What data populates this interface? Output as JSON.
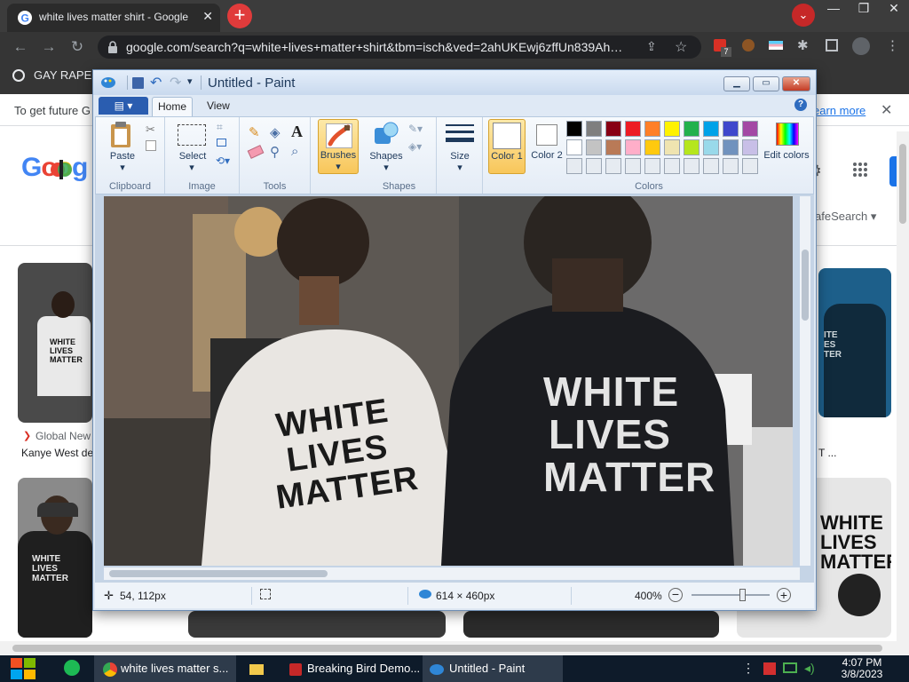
{
  "browser": {
    "tab_title": "white lives matter shirt - Google",
    "url": "google.com/search?q=white+lives+matter+shirt&tbm=isch&ved=2ahUKEwj6zffUn839Ah…",
    "bookmark": "GAY RAPE",
    "extension_badge": "7"
  },
  "infobar": {
    "message": "To get future G",
    "learn_more": "earn more"
  },
  "google": {
    "logo": "Goog",
    "safesearch": "afeSearch",
    "result1_source": "Global New",
    "result1_caption": "Kanye West de",
    "result_right_caption": "T ..."
  },
  "shirt_text": {
    "white": "WHITE",
    "lives": "LIVES",
    "matter": "MATTER",
    "partial": "ITE\nES\nTER"
  },
  "paint": {
    "title": "Untitled - Paint",
    "tabs": {
      "file": "",
      "home": "Home",
      "view": "View"
    },
    "groups": {
      "clipboard": "Clipboard",
      "image": "Image",
      "tools": "Tools",
      "shapes": "Shapes",
      "colors": "Colors"
    },
    "buttons": {
      "paste": "Paste",
      "select": "Select",
      "brushes": "Brushes",
      "shapes": "Shapes",
      "size": "Size",
      "color1": "Color 1",
      "color2": "Color 2",
      "edit_colors": "Edit colors"
    },
    "palette_row1": [
      "#000000",
      "#7f7f7f",
      "#880015",
      "#ed1c24",
      "#ff7f27",
      "#fff200",
      "#22b14c",
      "#00a2e8",
      "#3f48cc",
      "#a349a4"
    ],
    "palette_row2": [
      "#ffffff",
      "#c3c3c3",
      "#b97a57",
      "#ffaec9",
      "#ffc90e",
      "#efe4b0",
      "#b5e61d",
      "#99d9ea",
      "#7092be",
      "#c8bfe7"
    ],
    "status": {
      "cursor": "54, 112px",
      "dimensions": "614 × 460px",
      "zoom": "400%"
    }
  },
  "taskbar": {
    "item_chrome": "white lives matter s...",
    "item_demo": "Breaking Bird Demo...",
    "item_paint": "Untitled - Paint",
    "time": "4:07 PM",
    "date": "3/8/2023"
  }
}
